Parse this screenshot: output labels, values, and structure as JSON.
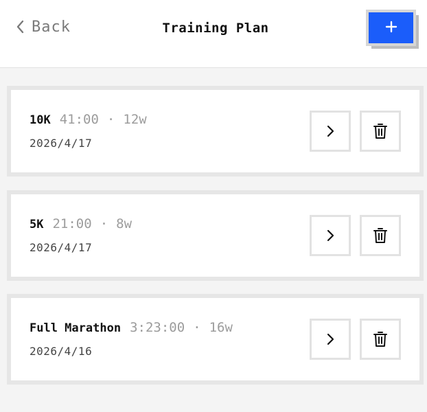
{
  "header": {
    "back_label": "Back",
    "title": "Training Plan",
    "add_label": "+"
  },
  "plans": [
    {
      "name": "10K",
      "target_time": "41:00",
      "separator": "·",
      "duration": "12w",
      "date": "2026/4/17"
    },
    {
      "name": "5K",
      "target_time": "21:00",
      "separator": "·",
      "duration": "8w",
      "date": "2026/4/17"
    },
    {
      "name": "Full Marathon",
      "target_time": "3:23:00",
      "separator": "·",
      "duration": "16w",
      "date": "2026/4/16"
    }
  ],
  "icons": {
    "back": "chevron-left-icon",
    "open": "chevron-right-icon",
    "delete": "trash-icon"
  },
  "colors": {
    "accent": "#1b5dfa",
    "muted_text": "#9c9c9c",
    "background": "#f4f4f4"
  }
}
